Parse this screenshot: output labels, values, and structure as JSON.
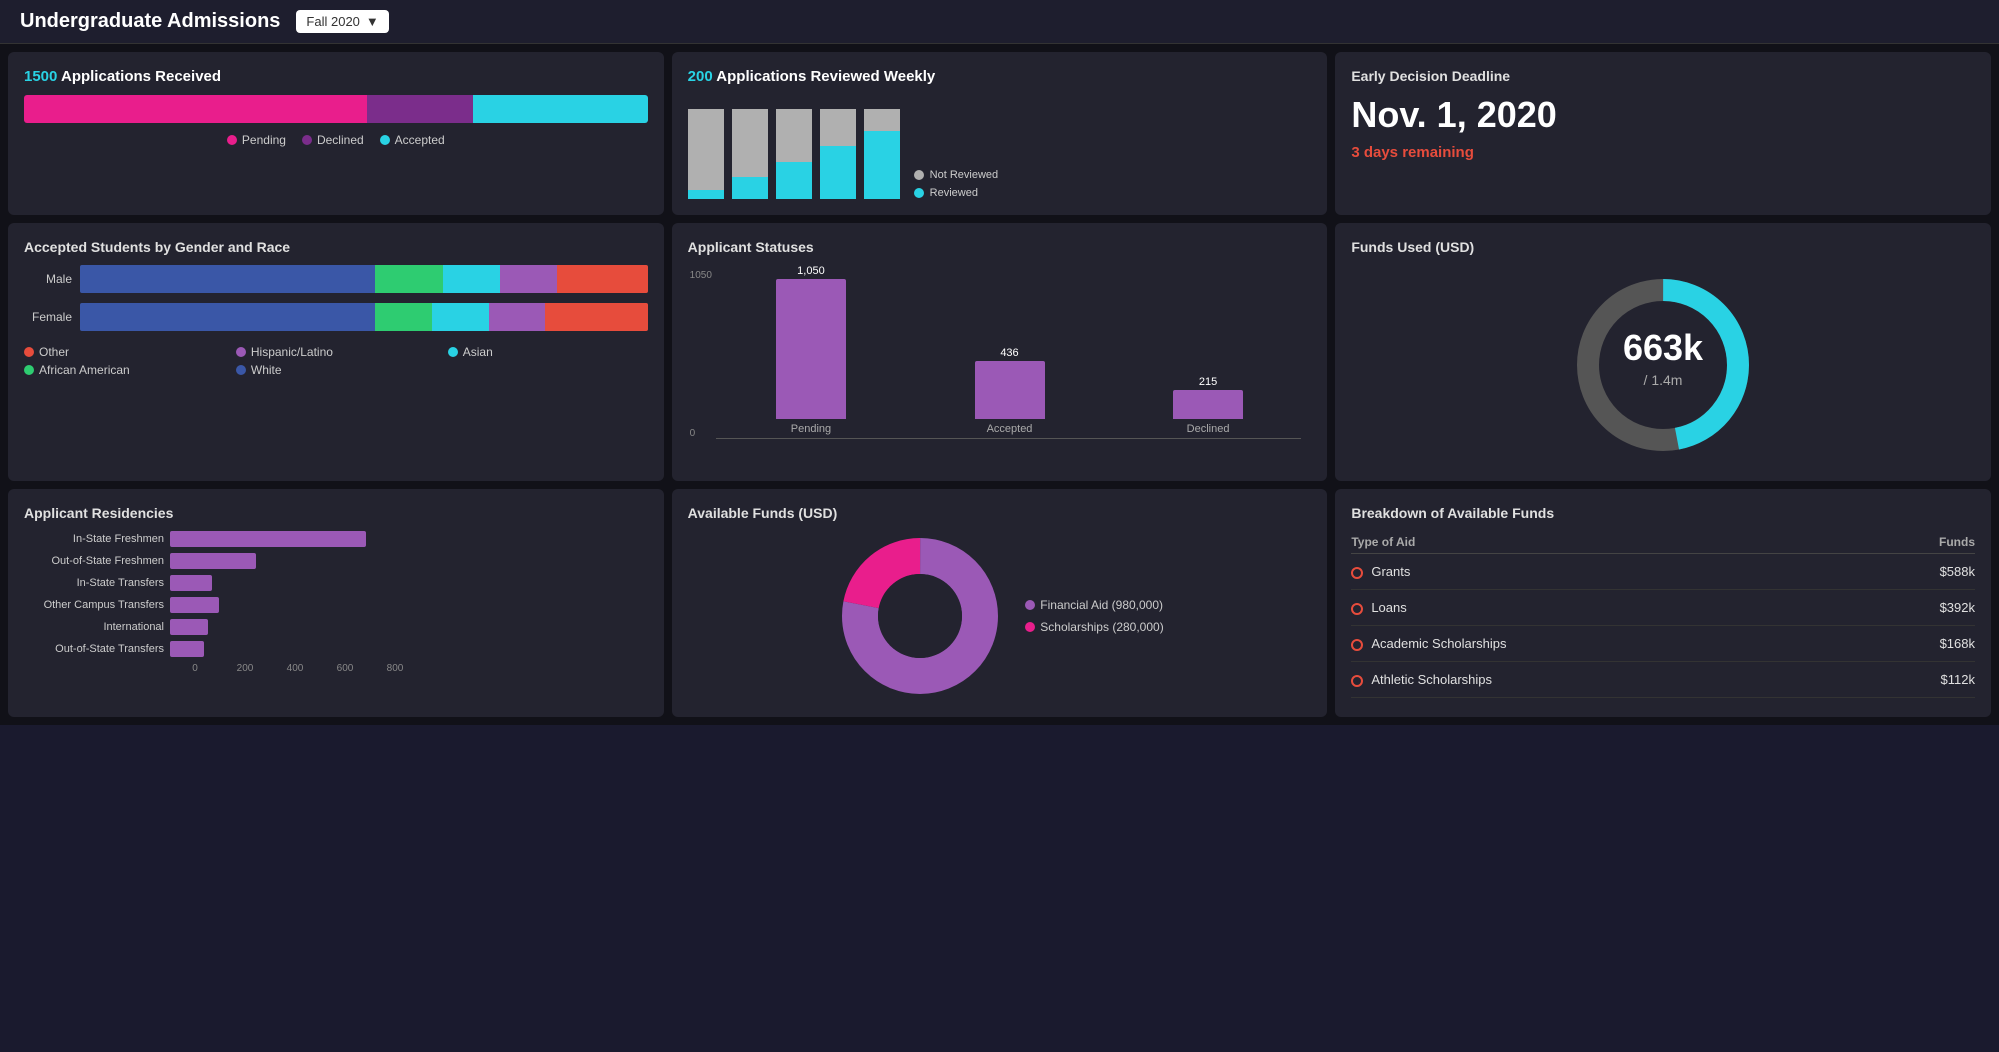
{
  "header": {
    "title": "Undergraduate Admissions",
    "dropdown_label": "Fall 2020",
    "dropdown_arrow": "▼"
  },
  "apps_received": {
    "number": "1500",
    "text": " Applications Received",
    "bar_pending_pct": 55,
    "bar_declined_pct": 17,
    "bar_accepted_pct": 28,
    "legend_pending": "Pending",
    "legend_declined": "Declined",
    "legend_accepted": "Accepted",
    "colors": {
      "pending": "#e91e8c",
      "declined": "#7b2d8b",
      "accepted": "#29d2e4"
    }
  },
  "apps_weekly": {
    "number": "200",
    "text": " Applications Reviewed Weekly",
    "legend_not_reviewed": "Not Reviewed",
    "legend_reviewed": "Reviewed",
    "bars": [
      {
        "not_reviewed": 90,
        "reviewed": 10
      },
      {
        "not_reviewed": 70,
        "reviewed": 22
      },
      {
        "not_reviewed": 55,
        "reviewed": 38
      },
      {
        "not_reviewed": 40,
        "reviewed": 55
      },
      {
        "not_reviewed": 25,
        "reviewed": 70
      }
    ]
  },
  "early_decision": {
    "title": "Early Decision Deadline",
    "date": "Nov. 1, 2020",
    "days_remaining": "3 days remaining"
  },
  "gender_race": {
    "title": "Accepted Students by Gender and Race",
    "rows": [
      {
        "label": "Male",
        "segments": [
          {
            "color": "#3a57a7",
            "pct": 52
          },
          {
            "color": "#2ecc71",
            "pct": 12
          },
          {
            "color": "#29d2e4",
            "pct": 10
          },
          {
            "color": "#9b59b6",
            "pct": 10
          },
          {
            "color": "#e74c3c",
            "pct": 16
          }
        ]
      },
      {
        "label": "Female",
        "segments": [
          {
            "color": "#3a57a7",
            "pct": 52
          },
          {
            "color": "#2ecc71",
            "pct": 10
          },
          {
            "color": "#29d2e4",
            "pct": 10
          },
          {
            "color": "#9b59b6",
            "pct": 10
          },
          {
            "color": "#e74c3c",
            "pct": 18
          }
        ]
      }
    ],
    "legend": [
      {
        "color": "#e74c3c",
        "label": "Other"
      },
      {
        "color": "#9b59b6",
        "label": "Hispanic/Latino"
      },
      {
        "color": "#29d2e4",
        "label": "Asian"
      },
      {
        "color": "#2ecc71",
        "label": "African American"
      },
      {
        "color": "#3a57a7",
        "label": "White"
      }
    ]
  },
  "statuses": {
    "title": "Applicant Statuses",
    "y_top": "1050",
    "y_bottom": "0",
    "bars": [
      {
        "label": "Pending",
        "value": 1050,
        "height_pct": 100
      },
      {
        "label": "Accepted",
        "value": 436,
        "height_pct": 41
      },
      {
        "label": "Declined",
        "value": 215,
        "height_pct": 20
      }
    ]
  },
  "funds_used": {
    "title": "Funds Used (USD)",
    "value": "663k",
    "total": "/ 1.4m",
    "percent_used": 47,
    "color_used": "#29d2e4",
    "color_remaining": "#555"
  },
  "residencies": {
    "title": "Applicant Residencies",
    "max_value": 800,
    "rows": [
      {
        "label": "In-State Freshmen",
        "value": 800
      },
      {
        "label": "Out-of-State Freshmen",
        "value": 350
      },
      {
        "label": "In-State Transfers",
        "value": 170
      },
      {
        "label": "Other Campus Transfers",
        "value": 200
      },
      {
        "label": "International",
        "value": 155
      },
      {
        "label": "Out-of-State Transfers",
        "value": 140
      }
    ],
    "axis_labels": [
      "0",
      "200",
      "400",
      "600",
      "800"
    ]
  },
  "available_funds": {
    "title": "Available Funds (USD)",
    "segments": [
      {
        "label": "Financial Aid (980,000)",
        "value": 980000,
        "color": "#9b59b6",
        "pct": 78
      },
      {
        "label": "Scholarships (280,000)",
        "value": 280000,
        "color": "#e91e8c",
        "pct": 22
      }
    ]
  },
  "breakdown": {
    "title": "Breakdown of Available Funds",
    "col_type": "Type of Aid",
    "col_funds": "Funds",
    "rows": [
      {
        "label": "Grants",
        "value": "$588k",
        "dot_color": "#e74c3c"
      },
      {
        "label": "Loans",
        "value": "$392k",
        "dot_color": "#e74c3c"
      },
      {
        "label": "Academic Scholarships",
        "value": "$168k",
        "dot_color": "#e74c3c"
      },
      {
        "label": "Athletic Scholarships",
        "value": "$112k",
        "dot_color": "#e74c3c"
      }
    ]
  }
}
